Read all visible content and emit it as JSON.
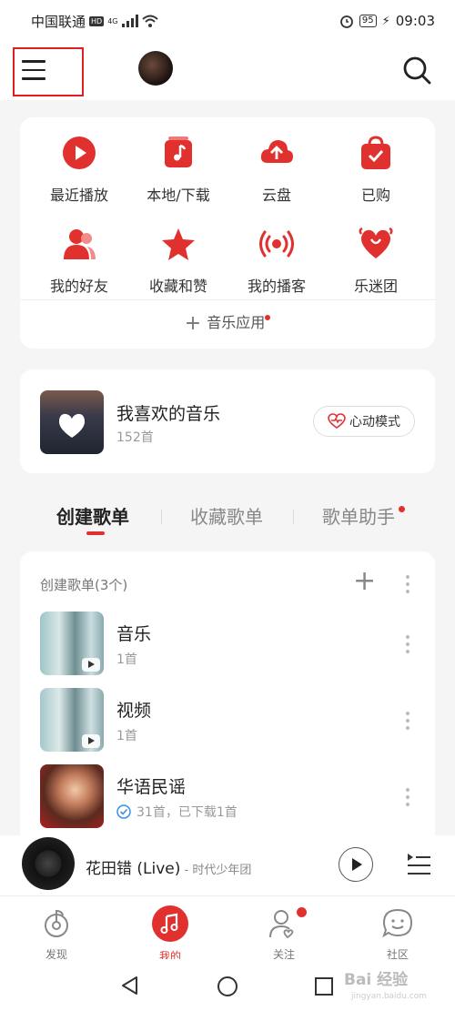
{
  "status_bar": {
    "carrier": "中国联通",
    "hd": "HD",
    "signal": "4G",
    "battery": "95",
    "time": "09:03"
  },
  "header": {
    "menu_icon": "menu-icon",
    "avatar": "user-avatar",
    "search_icon": "search-icon"
  },
  "shortcuts": [
    {
      "label": "最近播放",
      "icon": "play-circle-icon"
    },
    {
      "label": "本地/下载",
      "icon": "music-file-icon"
    },
    {
      "label": "云盘",
      "icon": "cloud-upload-icon"
    },
    {
      "label": "已购",
      "icon": "shopping-bag-icon"
    },
    {
      "label": "我的好友",
      "icon": "friends-icon"
    },
    {
      "label": "收藏和赞",
      "icon": "star-icon"
    },
    {
      "label": "我的播客",
      "icon": "podcast-icon"
    },
    {
      "label": "乐迷团",
      "icon": "fan-heart-icon"
    }
  ],
  "music_apps": {
    "label": "音乐应用"
  },
  "favorites": {
    "title": "我喜欢的音乐",
    "count": "152首",
    "heart_mode": "心动模式"
  },
  "tabs": [
    {
      "label": "创建歌单",
      "active": true
    },
    {
      "label": "收藏歌单",
      "active": false
    },
    {
      "label": "歌单助手",
      "active": false
    }
  ],
  "playlist_section": {
    "header": "创建歌单(3个)"
  },
  "playlists": [
    {
      "name": "音乐",
      "sub": "1首"
    },
    {
      "name": "视频",
      "sub": "1首"
    },
    {
      "name": "华语民谣",
      "sub": "31首，已下载1首"
    }
  ],
  "now_playing": {
    "title": "花田错 (Live)",
    "artist": " - 时代少年团"
  },
  "tabbar": [
    {
      "label": "发现",
      "icon": "discover-icon"
    },
    {
      "label": "我的",
      "icon": "music-note-icon"
    },
    {
      "label": "关注",
      "icon": "follow-user-icon"
    },
    {
      "label": "社区",
      "icon": "community-chat-icon"
    }
  ],
  "watermark": {
    "text": "Bai 经验",
    "sub": "jingyan.baidu.com"
  },
  "colors": {
    "accent": "#e0312f",
    "background": "#f5f5f5"
  }
}
